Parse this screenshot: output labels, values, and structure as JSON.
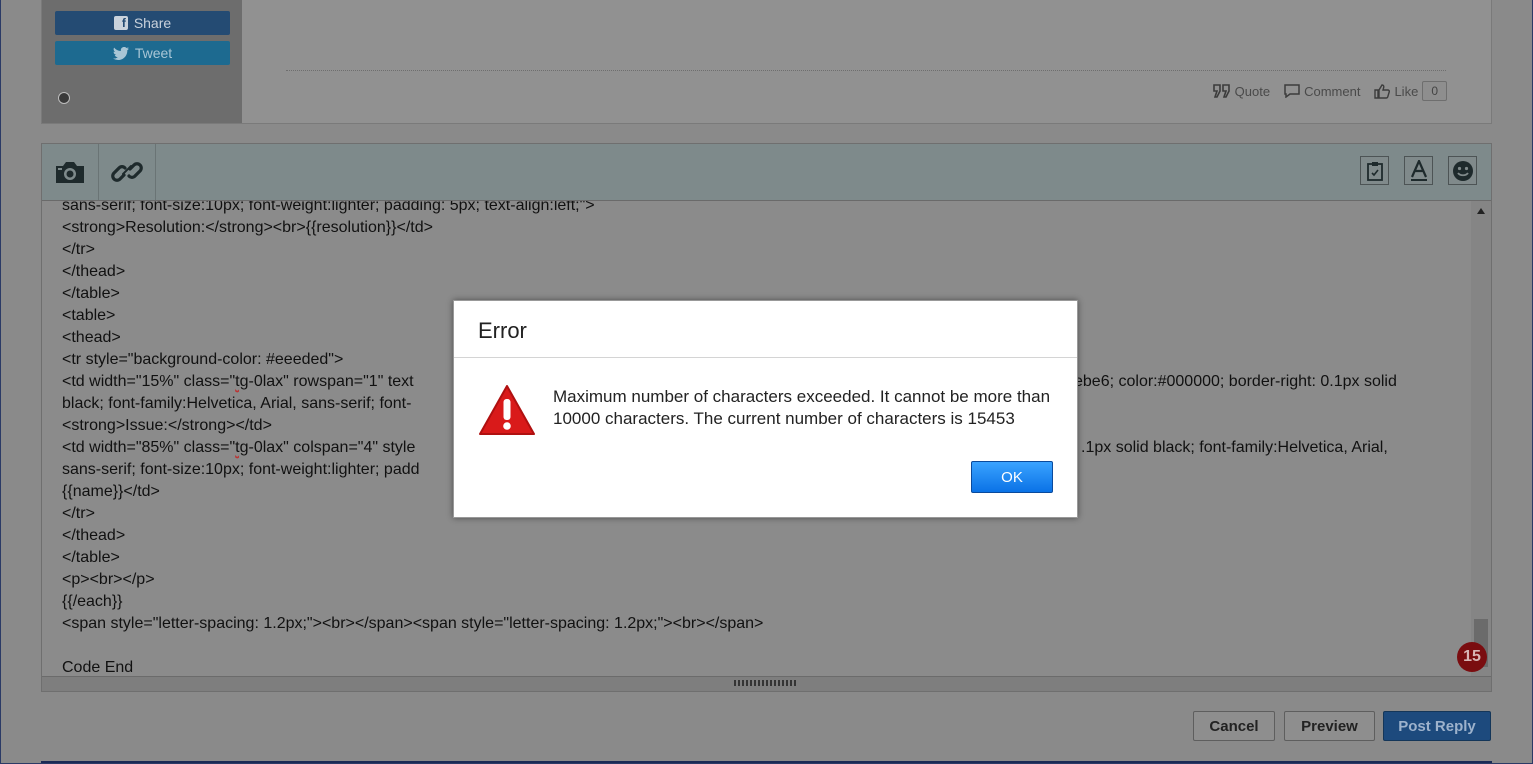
{
  "post": {
    "share_label": "Share",
    "tweet_label": "Tweet",
    "quote_label": "Quote",
    "comment_label": "Comment",
    "like_label": "Like",
    "like_count": "0"
  },
  "editor": {
    "lines": [
      "sans-serif; font-size:10px; font-weight:lighter; padding: 5px; text-align:left;\">",
      "<strong>Resolution:</strong><br>{{resolution}}</td>",
      "</tr>",
      "</thead>",
      "</table>",
      "<table>",
      "<thead>",
      "<tr style=\"background-color: #eeeded\">"
    ],
    "line_td1_a": "<td width=\"15%\" class=\"",
    "line_td1_spell": "tg",
    "line_td1_b": "-0lax\" rowspan=\"1\" text",
    "line_td1_c": "ebe6; color:#000000; border-right: 0.1px solid",
    "line_td1_d": "black; font-family:Helvetica, Arial, sans-serif; font-",
    "line_issue": "<strong>Issue:</strong></td>",
    "line_td2_a": "<td width=\"85%\" class=\"",
    "line_td2_spell": "tg",
    "line_td2_b": "-0lax\" colspan=\"4\" style",
    "line_td2_c": ".1px solid black; font-family:Helvetica, Arial,",
    "line_td2_d": "sans-serif; font-size:10px; font-weight:lighter; padd",
    "lines2": [
      "{{name}}</td>",
      "</tr>",
      "</thead>",
      "</table>",
      "<p><br></p>",
      "{{/each}}",
      "<span style=\"letter-spacing: 1.2px;\"><br></span><span style=\"letter-spacing: 1.2px;\"><br></span>",
      "",
      "Code End"
    ],
    "char_badge": "15"
  },
  "buttons": {
    "cancel": "Cancel",
    "preview": "Preview",
    "post_reply": "Post Reply"
  },
  "modal": {
    "title": "Error",
    "message": "Maximum number of characters exceeded. It cannot be more than 10000 characters. The current number of characters is 15453",
    "ok": "OK"
  }
}
